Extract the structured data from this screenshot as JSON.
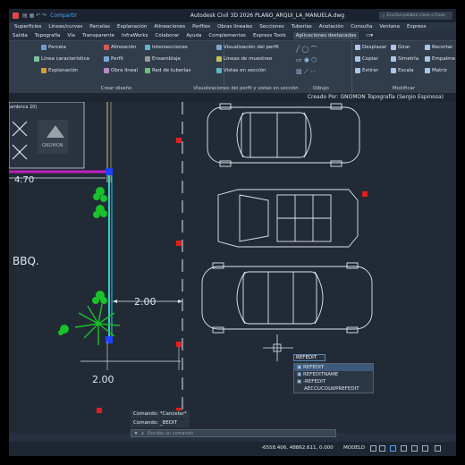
{
  "titlebar": {
    "share": "Compartir",
    "title": "Autodesk Civil 3D 2026   PLANO_ARQUI_LA_MANUELA.dwg",
    "search_placeholder": "Escriba palabra clave o frase"
  },
  "menu": [
    "Superficies",
    "Líneas/curvas",
    "Parcelas",
    "Explanación",
    "Alineaciones",
    "Perfiles",
    "Obras lineales",
    "Secciones",
    "Tuberías",
    "Anotación",
    "Consulta",
    "Ventana",
    "Express"
  ],
  "tabs": [
    "Salida",
    "Topografía",
    "Vía",
    "Transparente",
    "InfraWorks",
    "Colaborar",
    "Ayuda",
    "Complementos",
    "Express Tools",
    "Aplicaciones destacadas"
  ],
  "ribbon": {
    "panel1": {
      "items": [
        "Parcela",
        "Línea característica",
        "Explanación"
      ],
      "label": "Crear diseño"
    },
    "panel1b": {
      "items": [
        "Alineación",
        "Perfil",
        "Obra lineal"
      ]
    },
    "panel1c": {
      "items": [
        "Intersecciones",
        "Ensamblaje",
        "Red de tuberías"
      ]
    },
    "panel2": {
      "items": [
        "Visualización del perfil",
        "Líneas de muestreo",
        "Vistas en sección"
      ],
      "label": "Visualizaciones del perfil y vistas en sección"
    },
    "panel3": {
      "label": "Dibujo"
    },
    "panel4": {
      "items": [
        "Desplazar",
        "Copiar",
        "Estirar",
        "Girar",
        "Simetría",
        "Escala",
        "Recortar",
        "Empalme",
        "Matriz"
      ],
      "label": "Modificar"
    }
  },
  "viewbar": {
    "credit": "Creado Por: GNOMON Topografía (Sergio Espinosa)"
  },
  "drawing": {
    "dim1": "4.70",
    "dim2": "2.00",
    "dim3": "2.00",
    "room": "BBQ.",
    "logo_text": "GNOMON",
    "corner_label": "ambrica 20)"
  },
  "autocomplete": {
    "typed": "REFEDIT",
    "options": [
      "REFEDIT",
      "REFEDITNAME",
      "-REFEDIT",
      "AECCUCOLWPREFEDIT"
    ]
  },
  "command": {
    "history": [
      "Comando: *Cancelar*",
      "Comando: _BEDIT"
    ],
    "placeholder": "Escriba un comando"
  },
  "status": {
    "coords": "-6558.406, 48862.611, 0.000",
    "model": "MODELO"
  },
  "colors": {
    "accent": "#4da3ff",
    "canvas": "#222a36",
    "cyan": "#27d3d3",
    "red": "#e0201e",
    "green": "#19c12a"
  }
}
